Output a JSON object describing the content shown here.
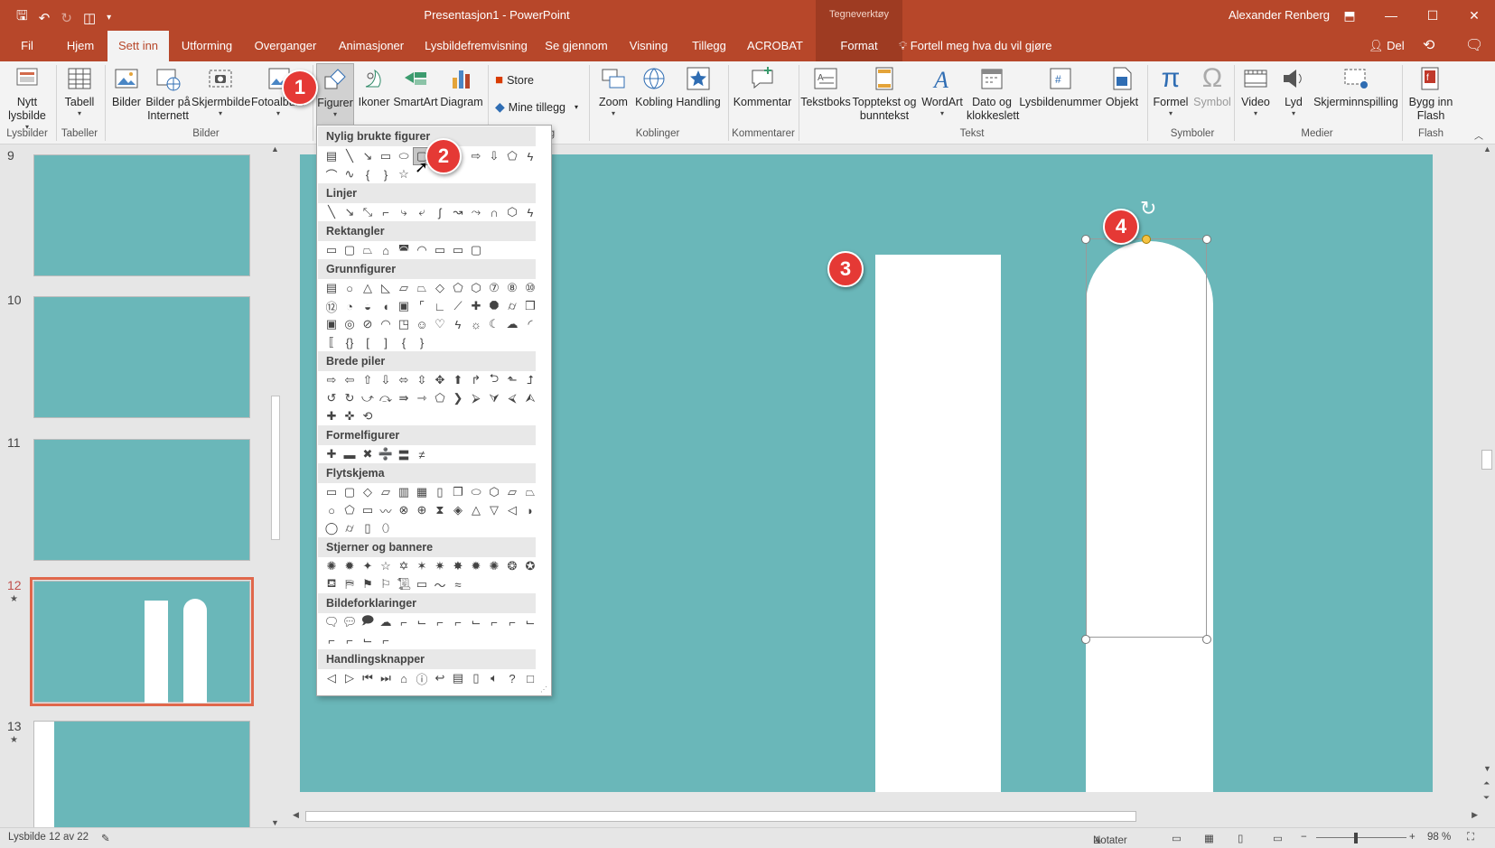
{
  "titlebar": {
    "doc_title": "Presentasjon1 - PowerPoint",
    "context_tab": "Tegneverktøy",
    "user": "Alexander Renberg"
  },
  "tabs": [
    "Fil",
    "Hjem",
    "Sett inn",
    "Utforming",
    "Overganger",
    "Animasjoner",
    "Lysbildefremvisning",
    "Se gjennom",
    "Visning",
    "Tillegg",
    "ACROBAT",
    "Format"
  ],
  "active_tab": "Sett inn",
  "tellme": "Fortell meg hva du vil gjøre",
  "share": "Del",
  "ribbon": {
    "nytt_lysbilde": "Nytt lysbilde",
    "tabell": "Tabell",
    "bilder": "Bilder",
    "bilder_internett": "Bilder på Internett",
    "skjermbilde": "Skjermbilde",
    "fotoalbum": "Fotoalbum",
    "figurer": "Figurer",
    "ikoner": "Ikoner",
    "smartart": "SmartArt",
    "diagram": "Diagram",
    "store": "Store",
    "mine_tillegg": "Mine tillegg",
    "zoom": "Zoom",
    "kobling": "Kobling",
    "handling": "Handling",
    "kommentar": "Kommentar",
    "tekstboks": "Tekstboks",
    "topptekst": "Topptekst og bunntekst",
    "wordart": "WordArt",
    "dato": "Dato og klokkeslett",
    "lysbildenummer": "Lysbildenummer",
    "objekt": "Objekt",
    "formel": "Formel",
    "symbol": "Symbol",
    "video": "Video",
    "lyd": "Lyd",
    "skjerminnspilling": "Skjerminnspilling",
    "bygg_flash": "Bygg inn Flash",
    "groups": {
      "lysbilder": "Lysbilder",
      "tabeller": "Tabeller",
      "bilder": "Bilder",
      "tillegg_frag": "g",
      "koblinger": "Koblinger",
      "kommentarer": "Kommentarer",
      "tekst": "Tekst",
      "symboler": "Symboler",
      "medier": "Medier",
      "flash": "Flash"
    }
  },
  "shapes_menu": {
    "sections": [
      "Nylig brukte figurer",
      "Linjer",
      "Rektangler",
      "Grunnfigurer",
      "Brede piler",
      "Formelfigurer",
      "Flytskjema",
      "Stjerner og bannere",
      "Bildeforklaringer",
      "Handlingsknapper"
    ]
  },
  "thumbnails": [
    {
      "num": "9",
      "star": ""
    },
    {
      "num": "10",
      "star": ""
    },
    {
      "num": "11",
      "star": ""
    },
    {
      "num": "12",
      "star": "★"
    },
    {
      "num": "13",
      "star": "★"
    }
  ],
  "badges": [
    "1",
    "2",
    "3",
    "4"
  ],
  "statusbar": {
    "slide_info": "Lysbilde 12 av 22",
    "notes": "Notater",
    "zoom": "98 %"
  },
  "colors": {
    "accent": "#b7472a",
    "slide_bg": "#6ab7b9",
    "badge": "#e53935"
  }
}
